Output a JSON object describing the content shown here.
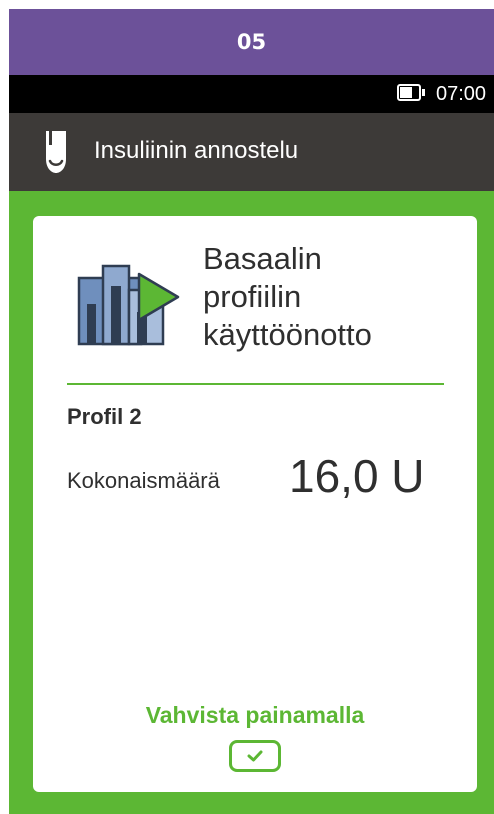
{
  "step_banner": {
    "label": "05",
    "color": "#6c5199"
  },
  "status_bar": {
    "time": "07:00",
    "battery_icon": "battery-icon"
  },
  "header": {
    "title": "Insuliinin annostelu",
    "icon": "insulin-pump-icon"
  },
  "card": {
    "icon": "basal-profile-start-icon",
    "title_lines": [
      "Basaalin",
      "profiilin",
      "käyttöönotto"
    ],
    "profile_name": "Profil 2",
    "total_label": "Kokonaismäärä",
    "total_value": "16,0 U"
  },
  "confirm": {
    "label": "Vahvista painamalla",
    "icon": "checkmark-icon"
  },
  "colors": {
    "accent_green": "#5cb734",
    "header_bg": "#3d3a38",
    "status_bg": "#000000"
  }
}
